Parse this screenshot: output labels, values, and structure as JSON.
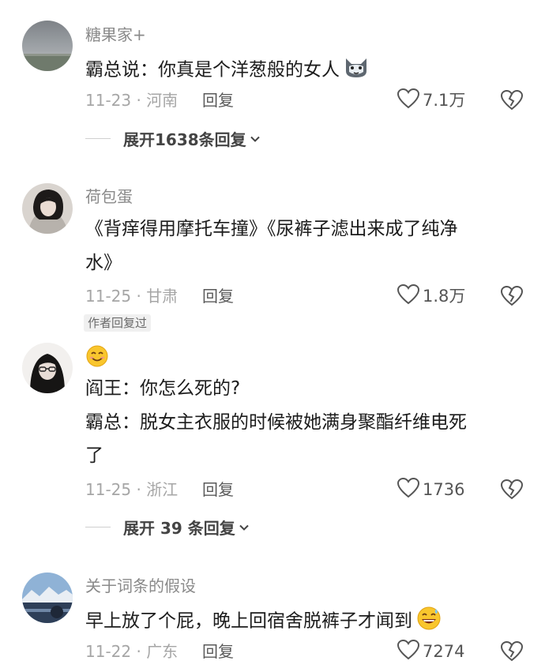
{
  "comments": [
    {
      "username": "糖果家+",
      "lines": [
        "霸总说：你真是个洋葱般的女人"
      ],
      "emoji": "cat-face-emoji",
      "time": "11-23 · 河南",
      "reply_label": "回复",
      "likes": "7.1万",
      "expand": "展开1638条回复"
    },
    {
      "username": "荷包蛋",
      "lines": [
        "《背痒得用摩托车撞》《尿裤子滤出来成了纯净",
        "水》"
      ],
      "time": "11-25 · 甘肃",
      "reply_label": "回复",
      "likes": "1.8万",
      "badge": "作者回复过"
    },
    {
      "username": "",
      "username_emoji": "smiling-face-emoji",
      "lines": [
        "阎王：你怎么死的?",
        "霸总：脱女主衣服的时候被她满身聚酯纤维电死",
        "了"
      ],
      "time": "11-25 · 浙江",
      "reply_label": "回复",
      "likes": "1736",
      "expand": "展开 39 条回复"
    },
    {
      "username": "关于词条的假设",
      "lines": [
        "早上放了个屁，晚上回宿舍脱裤子才闻到"
      ],
      "emoji": "grinning-sweat-emoji",
      "time": "11-22 · 广东",
      "reply_label": "回复",
      "likes": "7274"
    }
  ],
  "colors": {
    "text_primary": "#1c1c1c",
    "text_secondary": "#8a8a8a",
    "meta": "#a6a6a6",
    "icon": "#555555"
  }
}
